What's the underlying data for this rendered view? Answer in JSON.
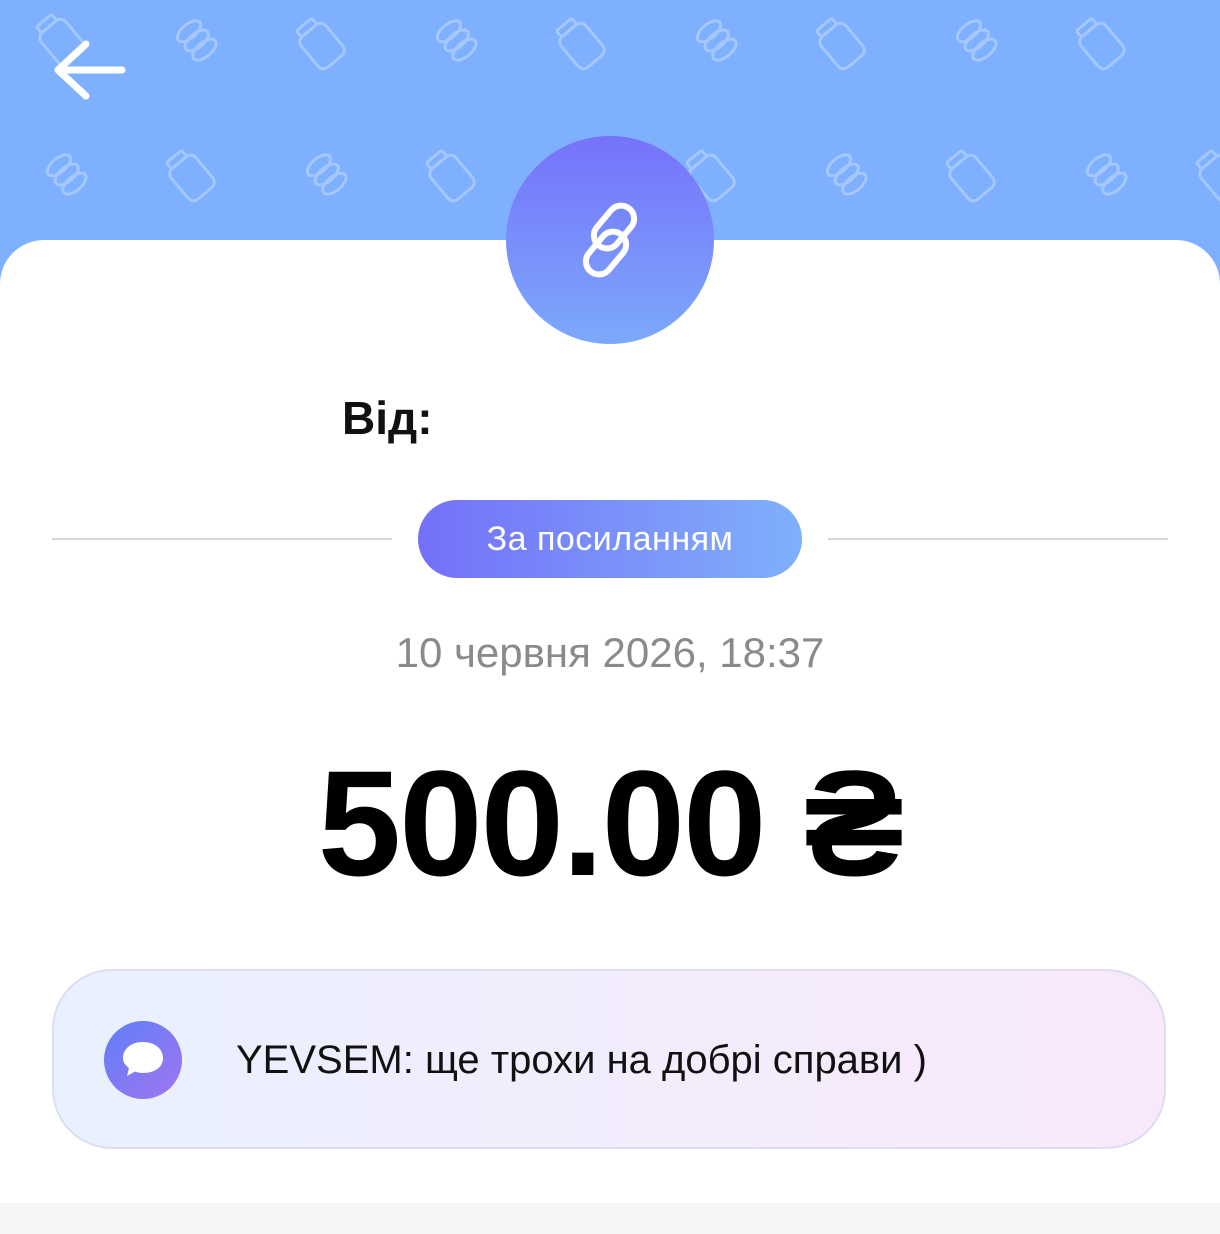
{
  "header": {
    "back_icon": "arrow-left-icon",
    "background_color": "#7fb0fd"
  },
  "avatar": {
    "icon": "link-icon"
  },
  "sender": {
    "label": "Від:"
  },
  "transfer_type": {
    "label": "За посиланням"
  },
  "date": "10 червня 2026, 18:37",
  "amount": "500.00 ₴",
  "comment": {
    "icon": "chat-bubble-icon",
    "text": "YEVSEM: ще трохи на добрі справи )"
  }
}
